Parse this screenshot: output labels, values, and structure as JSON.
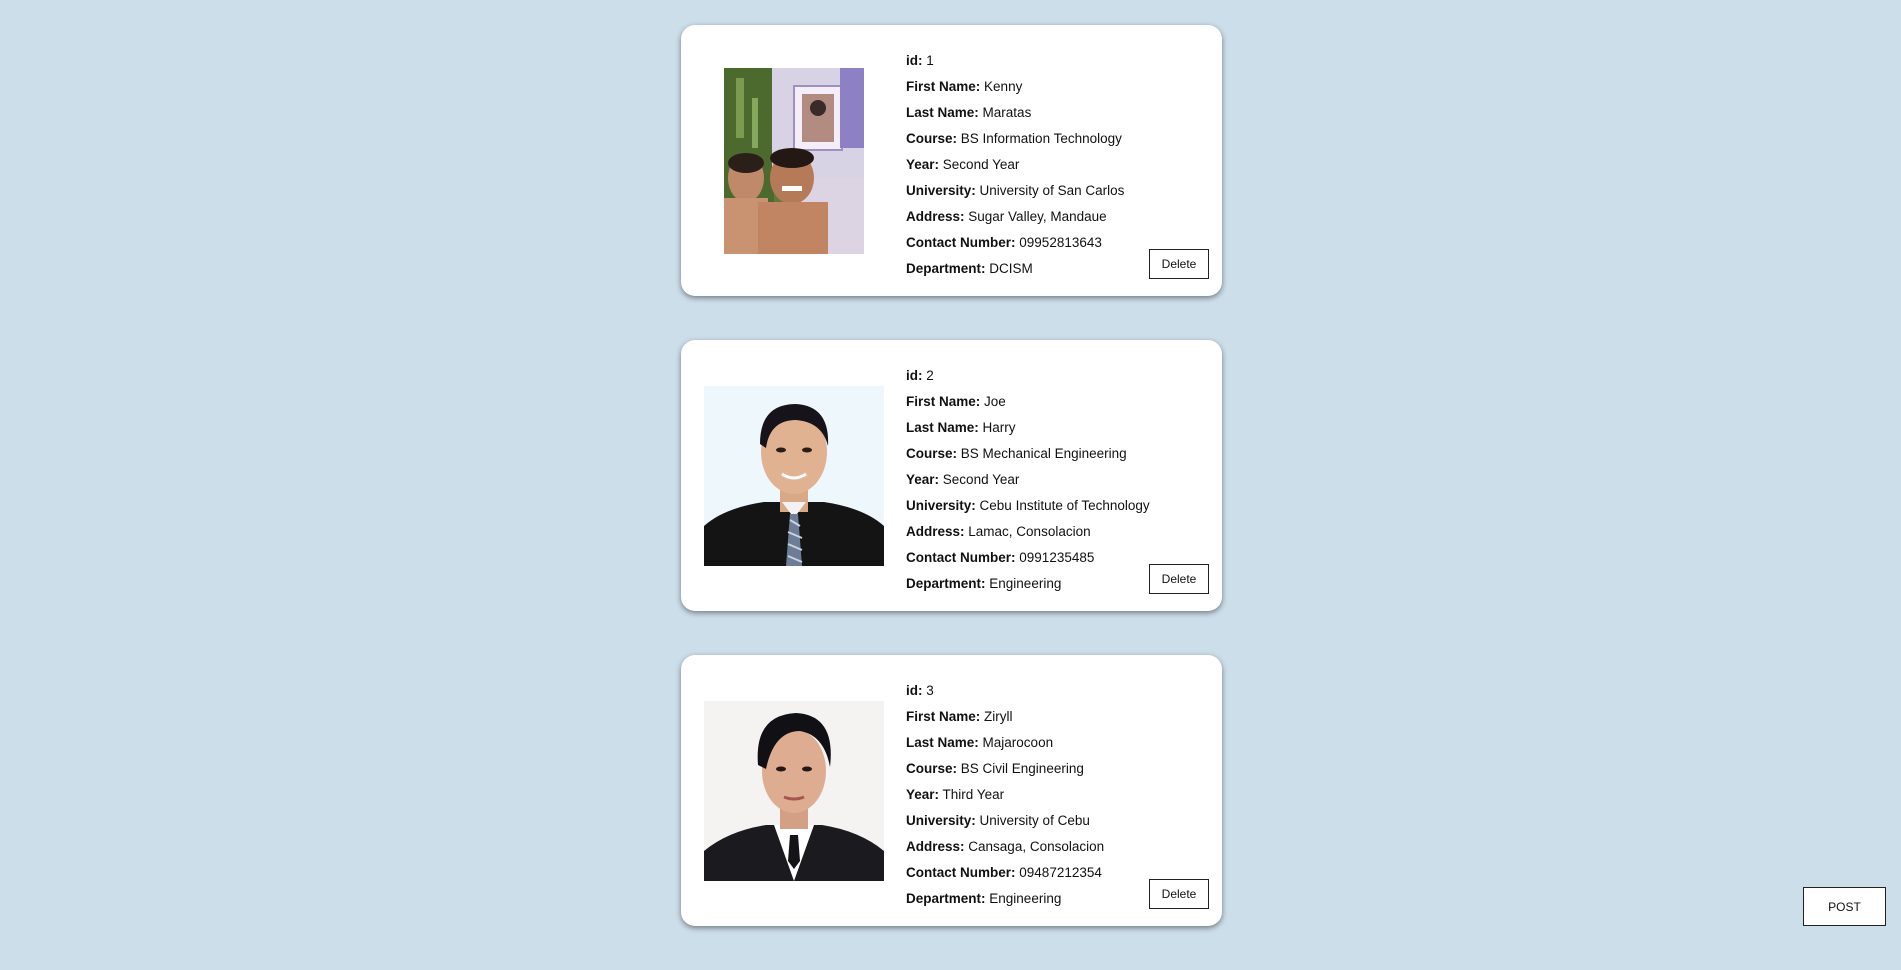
{
  "students": [
    {
      "photo_alt": "photo",
      "fields": [
        {
          "label": "id:",
          "value": "1"
        },
        {
          "label": "First Name:",
          "value": "Kenny"
        },
        {
          "label": "Last Name:",
          "value": "Maratas"
        },
        {
          "label": "Course:",
          "value": "BS Information Technology"
        },
        {
          "label": "Year:",
          "value": "Second Year"
        },
        {
          "label": "University:",
          "value": "University of San Carlos"
        },
        {
          "label": "Address:",
          "value": "Sugar Valley, Mandaue"
        },
        {
          "label": "Contact Number:",
          "value": "09952813643"
        },
        {
          "label": "Department:",
          "value": "DCISM"
        }
      ],
      "delete_label": "Delete"
    },
    {
      "photo_alt": "photo",
      "fields": [
        {
          "label": "id:",
          "value": "2"
        },
        {
          "label": "First Name:",
          "value": "Joe"
        },
        {
          "label": "Last Name:",
          "value": "Harry"
        },
        {
          "label": "Course:",
          "value": "BS Mechanical Engineering"
        },
        {
          "label": "Year:",
          "value": "Second Year"
        },
        {
          "label": "University:",
          "value": "Cebu Institute of Technology"
        },
        {
          "label": "Address:",
          "value": "Lamac, Consolacion"
        },
        {
          "label": "Contact Number:",
          "value": "0991235485"
        },
        {
          "label": "Department:",
          "value": "Engineering"
        }
      ],
      "delete_label": "Delete"
    },
    {
      "photo_alt": "photo",
      "fields": [
        {
          "label": "id:",
          "value": "3"
        },
        {
          "label": "First Name:",
          "value": "Ziryll"
        },
        {
          "label": "Last Name:",
          "value": "Majarocoon"
        },
        {
          "label": "Course:",
          "value": "BS Civil Engineering"
        },
        {
          "label": "Year:",
          "value": "Third Year"
        },
        {
          "label": "University:",
          "value": "University of Cebu"
        },
        {
          "label": "Address:",
          "value": "Cansaga, Consolacion"
        },
        {
          "label": "Contact Number:",
          "value": "09487212354"
        },
        {
          "label": "Department:",
          "value": "Engineering"
        }
      ],
      "delete_label": "Delete"
    }
  ],
  "post_label": "POST",
  "colors": {
    "page_background": "#cddeeb",
    "card_background": "#ffffff"
  }
}
